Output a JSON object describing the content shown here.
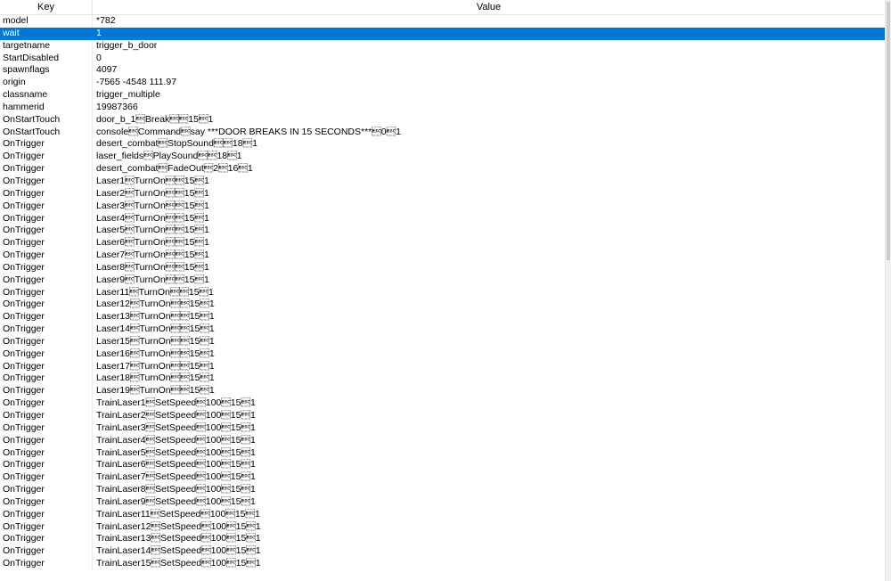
{
  "header": {
    "key": "Key",
    "value": "Value"
  },
  "selected_index": 1,
  "rows": [
    {
      "key": "model",
      "value": "*782"
    },
    {
      "key": "wait",
      "value": "1"
    },
    {
      "key": "targetname",
      "value": "trigger_b_door"
    },
    {
      "key": "StartDisabled",
      "value": "0"
    },
    {
      "key": "spawnflags",
      "value": "4097"
    },
    {
      "key": "origin",
      "value": "-7565 -4548 111.97"
    },
    {
      "key": "classname",
      "value": "trigger_multiple"
    },
    {
      "key": "hammerid",
      "value": "19987366"
    },
    {
      "key": "OnStartTouch",
      "value": "door_b_1\u001bBreak\u001b\u001b15\u001b1"
    },
    {
      "key": "OnStartTouch",
      "value": "console\u001bCommand\u001bsay ***DOOR BREAKS IN 15 SECONDS***\u001b0\u001b1"
    },
    {
      "key": "OnTrigger",
      "value": "desert_combat\u001bStopSound\u001b\u001b18\u001b1"
    },
    {
      "key": "OnTrigger",
      "value": "laser_fields\u001bPlaySound\u001b\u001b18\u001b1"
    },
    {
      "key": "OnTrigger",
      "value": "desert_combat\u001bFadeOut\u001b2\u001b16\u001b1"
    },
    {
      "key": "OnTrigger",
      "value": "Laser1\u001bTurnOn\u001b\u001b15\u001b1"
    },
    {
      "key": "OnTrigger",
      "value": "Laser2\u001bTurnOn\u001b\u001b15\u001b1"
    },
    {
      "key": "OnTrigger",
      "value": "Laser3\u001bTurnOn\u001b\u001b15\u001b1"
    },
    {
      "key": "OnTrigger",
      "value": "Laser4\u001bTurnOn\u001b\u001b15\u001b1"
    },
    {
      "key": "OnTrigger",
      "value": "Laser5\u001bTurnOn\u001b\u001b15\u001b1"
    },
    {
      "key": "OnTrigger",
      "value": "Laser6\u001bTurnOn\u001b\u001b15\u001b1"
    },
    {
      "key": "OnTrigger",
      "value": "Laser7\u001bTurnOn\u001b\u001b15\u001b1"
    },
    {
      "key": "OnTrigger",
      "value": "Laser8\u001bTurnOn\u001b\u001b15\u001b1"
    },
    {
      "key": "OnTrigger",
      "value": "Laser9\u001bTurnOn\u001b\u001b15\u001b1"
    },
    {
      "key": "OnTrigger",
      "value": "Laser11\u001bTurnOn\u001b\u001b15\u001b1"
    },
    {
      "key": "OnTrigger",
      "value": "Laser12\u001bTurnOn\u001b\u001b15\u001b1"
    },
    {
      "key": "OnTrigger",
      "value": "Laser13\u001bTurnOn\u001b\u001b15\u001b1"
    },
    {
      "key": "OnTrigger",
      "value": "Laser14\u001bTurnOn\u001b\u001b15\u001b1"
    },
    {
      "key": "OnTrigger",
      "value": "Laser15\u001bTurnOn\u001b\u001b15\u001b1"
    },
    {
      "key": "OnTrigger",
      "value": "Laser16\u001bTurnOn\u001b\u001b15\u001b1"
    },
    {
      "key": "OnTrigger",
      "value": "Laser17\u001bTurnOn\u001b\u001b15\u001b1"
    },
    {
      "key": "OnTrigger",
      "value": "Laser18\u001bTurnOn\u001b\u001b15\u001b1"
    },
    {
      "key": "OnTrigger",
      "value": "Laser19\u001bTurnOn\u001b\u001b15\u001b1"
    },
    {
      "key": "OnTrigger",
      "value": "TrainLaser1\u001bSetSpeed\u001b100\u001b15\u001b1"
    },
    {
      "key": "OnTrigger",
      "value": "TrainLaser2\u001bSetSpeed\u001b100\u001b15\u001b1"
    },
    {
      "key": "OnTrigger",
      "value": "TrainLaser3\u001bSetSpeed\u001b100\u001b15\u001b1"
    },
    {
      "key": "OnTrigger",
      "value": "TrainLaser4\u001bSetSpeed\u001b100\u001b15\u001b1"
    },
    {
      "key": "OnTrigger",
      "value": "TrainLaser5\u001bSetSpeed\u001b100\u001b15\u001b1"
    },
    {
      "key": "OnTrigger",
      "value": "TrainLaser6\u001bSetSpeed\u001b100\u001b15\u001b1"
    },
    {
      "key": "OnTrigger",
      "value": "TrainLaser7\u001bSetSpeed\u001b100\u001b15\u001b1"
    },
    {
      "key": "OnTrigger",
      "value": "TrainLaser8\u001bSetSpeed\u001b100\u001b15\u001b1"
    },
    {
      "key": "OnTrigger",
      "value": "TrainLaser9\u001bSetSpeed\u001b100\u001b15\u001b1"
    },
    {
      "key": "OnTrigger",
      "value": "TrainLaser11\u001bSetSpeed\u001b100\u001b15\u001b1"
    },
    {
      "key": "OnTrigger",
      "value": "TrainLaser12\u001bSetSpeed\u001b100\u001b15\u001b1"
    },
    {
      "key": "OnTrigger",
      "value": "TrainLaser13\u001bSetSpeed\u001b100\u001b15\u001b1"
    },
    {
      "key": "OnTrigger",
      "value": "TrainLaser14\u001bSetSpeed\u001b100\u001b15\u001b1"
    },
    {
      "key": "OnTrigger",
      "value": "TrainLaser15\u001bSetSpeed\u001b100\u001b15\u001b1"
    }
  ],
  "colors": {
    "selection": "#0078d7",
    "header_border": "#e5e5e5"
  }
}
